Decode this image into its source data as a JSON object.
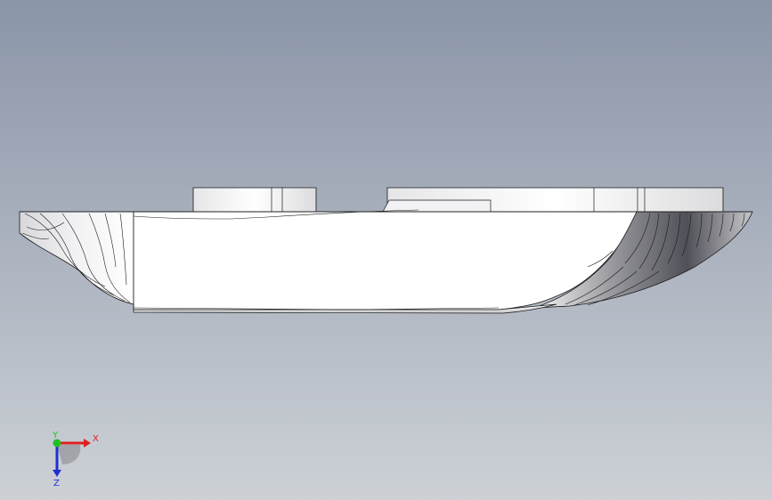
{
  "view": {
    "background_top": "#8a95a8",
    "background_bottom": "#cdd1d6",
    "part_face_color": "#ffffff",
    "part_shade_color": "#6b6b70",
    "edge_color": "#1a1a1a"
  },
  "triad": {
    "x_label": "X",
    "y_label": "Y",
    "z_label": "Z",
    "x_color": "#e02020",
    "y_color": "#20c020",
    "z_color": "#2030d0"
  }
}
